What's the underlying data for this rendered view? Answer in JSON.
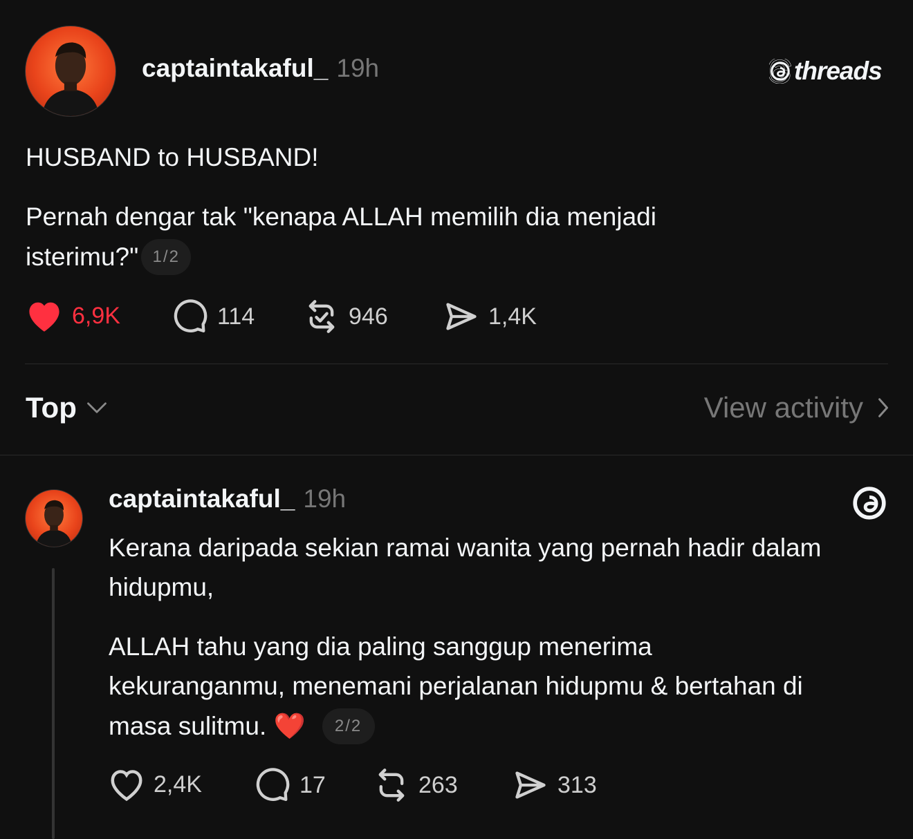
{
  "brand": {
    "logo_text": "threads"
  },
  "post": {
    "username": "captaintakaful_",
    "time": "19h",
    "paragraphs": [
      "HUSBAND to HUSBAND!",
      "Pernah dengar tak \"kenapa ALLAH memilih dia menjadi",
      "isterimu?\""
    ],
    "pager": "1/2",
    "actions": {
      "likes": "6,9K",
      "comments": "114",
      "reposts": "946",
      "shares": "1,4K"
    },
    "liked": true
  },
  "sort": {
    "label": "Top",
    "view_activity": "View activity"
  },
  "reply": {
    "username": "captaintakaful_",
    "time": "19h",
    "lines": [
      "Kerana daripada sekian ramai wanita yang pernah hadir dalam",
      "hidupmu,",
      "ALLAH tahu yang dia paling sanggup menerima",
      "kekuranganmu, menemani perjalanan hidupmu & bertahan di",
      "masa sulitmu. ❤️"
    ],
    "pager": "2/2",
    "actions": {
      "likes": "2,4K",
      "comments": "17",
      "reposts": "263",
      "shares": "313"
    }
  },
  "icons": {
    "heart": "heart-icon",
    "comment": "comment-icon",
    "repost": "repost-icon",
    "share": "share-icon",
    "threads": "threads-logo-icon",
    "chevron_down": "chevron-down-icon",
    "chevron_right": "chevron-right-icon"
  },
  "colors": {
    "background": "#101010",
    "text": "#f3f5f7",
    "muted": "#777777",
    "like": "#ff3040"
  }
}
